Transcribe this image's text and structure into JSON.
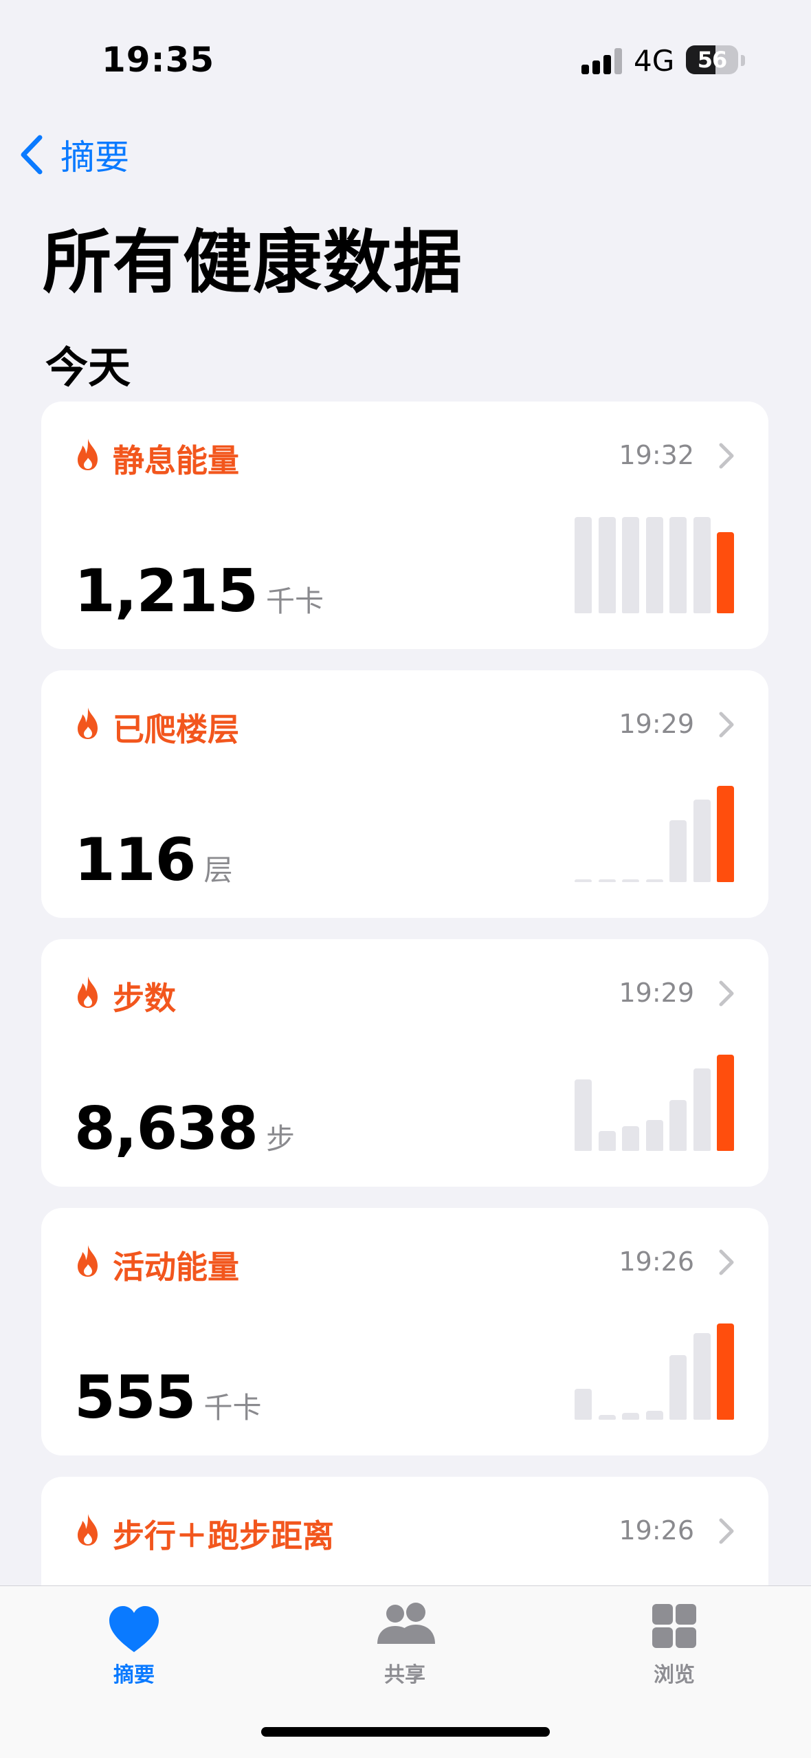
{
  "status_bar": {
    "time": "19:35",
    "network": "4G",
    "battery": "56",
    "battery_level": 0.56
  },
  "nav": {
    "back_label": "摘要",
    "title": "所有健康数据",
    "section": "今天"
  },
  "colors": {
    "accent": "#f2561d",
    "bar_today": "#ff4e0d",
    "bar_past": "#e5e5ea",
    "link": "#0a7aff"
  },
  "metrics": [
    {
      "icon": "flame-icon",
      "name": "静息能量",
      "time": "19:32",
      "value": "1,215",
      "unit": "千卡",
      "bars": [
        1.0,
        1.0,
        1.0,
        1.0,
        1.0,
        1.0,
        0.84
      ]
    },
    {
      "icon": "flame-icon",
      "name": "已爬楼层",
      "time": "19:29",
      "value": "116",
      "unit": "层",
      "bars": [
        0.03,
        0.0,
        0.01,
        0.0,
        0.64,
        0.86,
        1.0
      ]
    },
    {
      "icon": "flame-icon",
      "name": "步数",
      "time": "19:29",
      "value": "8,638",
      "unit": "步",
      "bars": [
        0.74,
        0.21,
        0.26,
        0.32,
        0.53,
        0.86,
        1.0
      ]
    },
    {
      "icon": "flame-icon",
      "name": "活动能量",
      "time": "19:26",
      "value": "555",
      "unit": "千卡",
      "bars": [
        0.32,
        0.05,
        0.07,
        0.09,
        0.67,
        0.9,
        1.0
      ]
    },
    {
      "icon": "flame-icon",
      "name": "步行＋跑步距离",
      "time": "19:26",
      "value": "",
      "unit": "",
      "bars": []
    }
  ],
  "tabs": [
    {
      "label": "摘要",
      "icon": "heart-icon",
      "active": true
    },
    {
      "label": "共享",
      "icon": "people-icon",
      "active": false
    },
    {
      "label": "浏览",
      "icon": "grid-icon",
      "active": false
    }
  ]
}
